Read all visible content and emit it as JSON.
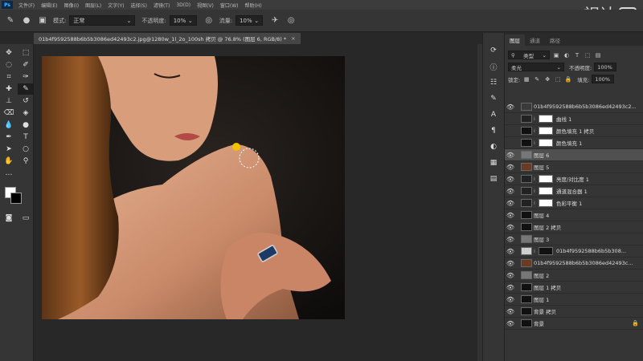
{
  "menubar": {
    "app": "Ps",
    "items": [
      "文件(F)",
      "编辑(E)",
      "图像(I)",
      "图层(L)",
      "文字(Y)",
      "选择(S)",
      "滤镜(T)",
      "3D(D)",
      "视图(V)",
      "窗口(W)",
      "帮助(H)"
    ],
    "watermark": "视达"
  },
  "options": {
    "mode_label": "模式:",
    "mode_value": "正常",
    "opacity_label": "不透明度:",
    "opacity_value": "10%",
    "flow_label": "流量:",
    "flow_value": "10%"
  },
  "document": {
    "tab_title": "01b4f9592588b6b5b3086ed42493c2.jpg@1280w_1l_2o_100sh 拷贝 @ 76.8% (图层 6, RGB/8) *",
    "close": "×"
  },
  "layers_panel": {
    "tabs": [
      "图层",
      "通道",
      "路径"
    ],
    "kind_label": "类型",
    "blend_mode": "柔光",
    "opacity_label": "不透明度:",
    "opacity_value": "100%",
    "lock_label": "锁定:",
    "fill_label": "填充:",
    "fill_value": "100%",
    "layers": [
      {
        "name": "01b4f9592588b6b5b3086ed42493c2...",
        "visible": true,
        "type": "smart"
      },
      {
        "name": "曲线 1",
        "visible": false,
        "type": "adjust"
      },
      {
        "name": "颜色填充 1 拷贝",
        "visible": false,
        "type": "fill"
      },
      {
        "name": "颜色填充 1",
        "visible": false,
        "type": "fill"
      },
      {
        "name": "图层 6",
        "visible": true,
        "type": "pixel",
        "selected": true
      },
      {
        "name": "图层 5",
        "visible": true,
        "type": "photo"
      },
      {
        "name": "亮度/对比度 1",
        "visible": true,
        "type": "adjust"
      },
      {
        "name": "通道混合器 1",
        "visible": true,
        "type": "adjust"
      },
      {
        "name": "色彩平衡 1",
        "visible": true,
        "type": "adjust"
      },
      {
        "name": "图层 4",
        "visible": true,
        "type": "dark"
      },
      {
        "name": "图层 2 拷贝",
        "visible": true,
        "type": "dark"
      },
      {
        "name": "图层 3",
        "visible": true,
        "type": "gray"
      },
      {
        "name": "01b4f9592588b6b5b308...",
        "visible": true,
        "type": "smartmask"
      },
      {
        "name": "01b4f9592588b6b5b3086ed42493c...",
        "visible": true,
        "type": "photo"
      },
      {
        "name": "图层 2",
        "visible": true,
        "type": "gray"
      },
      {
        "name": "图层 1 拷贝",
        "visible": true,
        "type": "dark"
      },
      {
        "name": "图层 1",
        "visible": true,
        "type": "dark"
      },
      {
        "name": "背景 拷贝",
        "visible": true,
        "type": "dark"
      },
      {
        "name": "背景",
        "visible": true,
        "type": "dark",
        "locked": true
      }
    ]
  },
  "colors": {
    "ui_bg": "#282828",
    "panel_bg": "#353535",
    "accent": "#4db8ff"
  }
}
